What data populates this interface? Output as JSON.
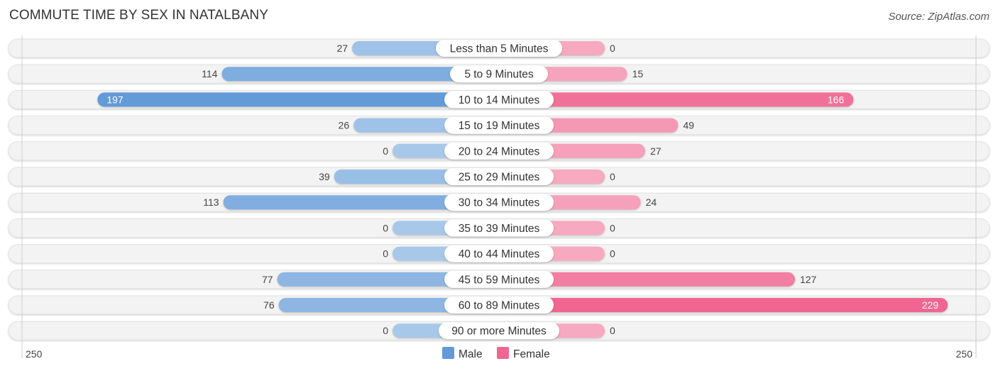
{
  "header": {
    "title": "COMMUTE TIME BY SEX IN NATALBANY",
    "source": "Source: ZipAtlas.com"
  },
  "colors": {
    "male_strong": "#6399d8",
    "male_light": "#a8c8ea",
    "female_strong": "#f06592",
    "female_light": "#f7a9c1",
    "row_bg": "#f3f3f3"
  },
  "chart_data": {
    "type": "bar",
    "orientation": "horizontal-diverging",
    "title": "COMMUTE TIME BY SEX IN NATALBANY",
    "categories": [
      "Less than 5 Minutes",
      "5 to 9 Minutes",
      "10 to 14 Minutes",
      "15 to 19 Minutes",
      "20 to 24 Minutes",
      "25 to 29 Minutes",
      "30 to 34 Minutes",
      "35 to 39 Minutes",
      "40 to 44 Minutes",
      "45 to 59 Minutes",
      "60 to 89 Minutes",
      "90 or more Minutes"
    ],
    "series": [
      {
        "name": "Male",
        "side": "left",
        "values": [
          27,
          114,
          197,
          26,
          0,
          39,
          113,
          0,
          0,
          77,
          76,
          0
        ]
      },
      {
        "name": "Female",
        "side": "right",
        "values": [
          0,
          15,
          166,
          49,
          27,
          0,
          24,
          0,
          0,
          127,
          229,
          0
        ]
      }
    ],
    "axis": {
      "left_max_label": "250",
      "right_max_label": "250",
      "xlim": [
        -250,
        250
      ]
    },
    "legend": {
      "position": "bottom-center",
      "entries": [
        "Male",
        "Female"
      ]
    },
    "grid": false
  }
}
